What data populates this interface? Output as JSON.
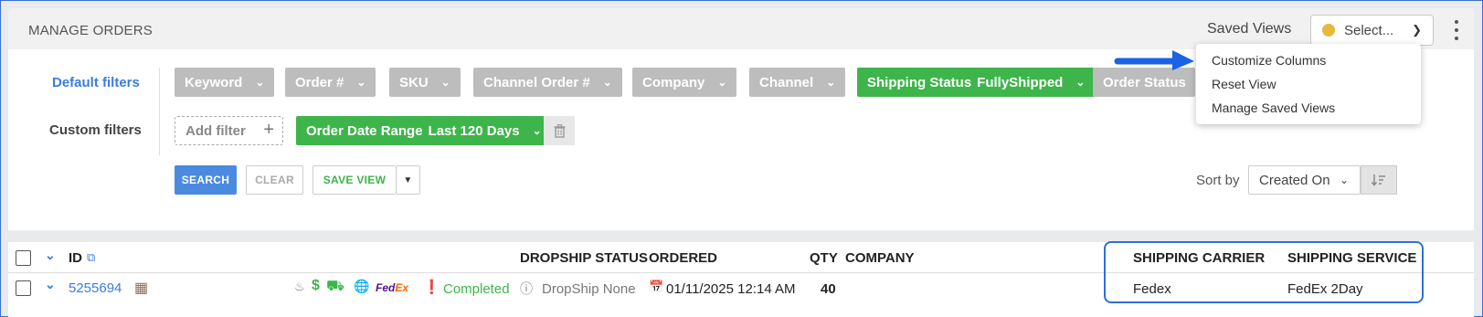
{
  "header": {
    "title": "MANAGE ORDERS",
    "saved_views_label": "Saved Views",
    "saved_views_value": "Select...",
    "saved_views_dot_color": "#e6b93a"
  },
  "menu": {
    "items": [
      "Customize Columns",
      "Reset View",
      "Manage Saved Views"
    ]
  },
  "filters": {
    "default_label": "Default filters",
    "custom_label": "Custom filters",
    "default_chips": [
      {
        "label": "Keyword",
        "value": ""
      },
      {
        "label": "Order #",
        "value": ""
      },
      {
        "label": "SKU",
        "value": ""
      },
      {
        "label": "Channel Order #",
        "value": ""
      },
      {
        "label": "Company",
        "value": ""
      },
      {
        "label": "Channel",
        "value": ""
      },
      {
        "label": "Shipping Status",
        "value": "FullyShipped"
      },
      {
        "label": "Order Status",
        "value": ""
      }
    ],
    "add_filter_label": "Add filter",
    "date_chip": {
      "label": "Order Date Range",
      "value": "Last 120 Days"
    },
    "active_color": "#3db54a",
    "inactive_color": "#bdbdbd"
  },
  "actions": {
    "search": "SEARCH",
    "clear": "CLEAR",
    "save_view": "SAVE VIEW"
  },
  "sort": {
    "label": "Sort by",
    "value": "Created On"
  },
  "grid": {
    "columns": {
      "id": "ID",
      "dropship_status": "DROPSHIP STATUS",
      "ordered": "ORDERED",
      "qty": "QTY",
      "company": "COMPANY",
      "shipping_carrier": "SHIPPING CARRIER",
      "shipping_service": "SHIPPING SERVICE"
    },
    "rows": [
      {
        "id": "5255694",
        "carrier_logo": {
          "fe": "Fed",
          "ex": "Ex"
        },
        "status": "Completed",
        "dropship_status": "DropShip None",
        "ordered": "01/11/2025 12:14 AM",
        "qty": "40",
        "company": "",
        "shipping_carrier": "Fedex",
        "shipping_service": "FedEx 2Day"
      }
    ]
  }
}
